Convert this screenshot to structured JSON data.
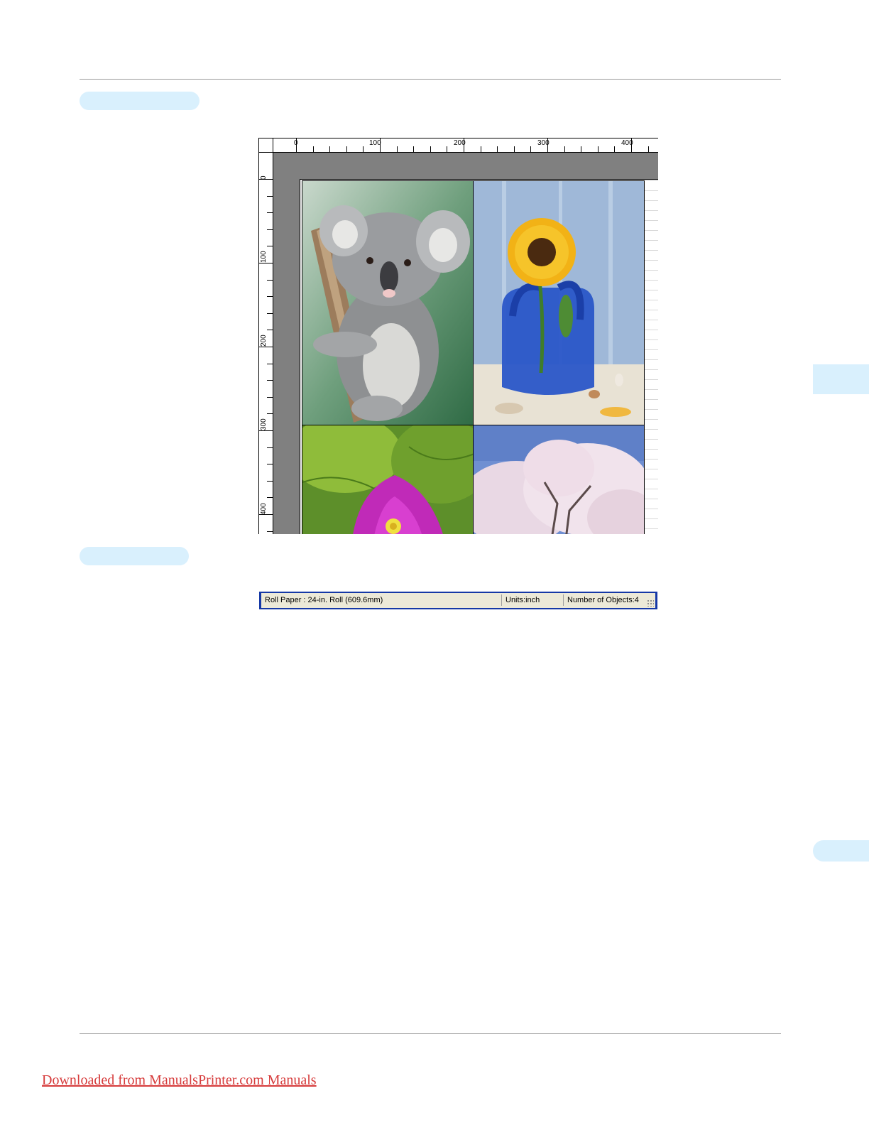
{
  "ruler": {
    "horizontal_labels": [
      "0",
      "100",
      "200",
      "300",
      "400"
    ],
    "vertical_labels": [
      "0",
      "100",
      "200",
      "300",
      "400"
    ]
  },
  "photos": [
    "koala-photo",
    "sunflower-vase-photo",
    "bougainvillea-flower-photo",
    "cherry-blossom-tree-photo"
  ],
  "status_bar": {
    "paper": "Roll Paper : 24-in. Roll (609.6mm)",
    "units": "Units:inch",
    "objects": "Number of Objects:4"
  },
  "footer": {
    "link_text": "Downloaded from ManualsPrinter.com Manuals"
  },
  "colors": {
    "pill": "#d9f0fd",
    "status_frame": "#1538a6",
    "link": "#d63b3b"
  }
}
